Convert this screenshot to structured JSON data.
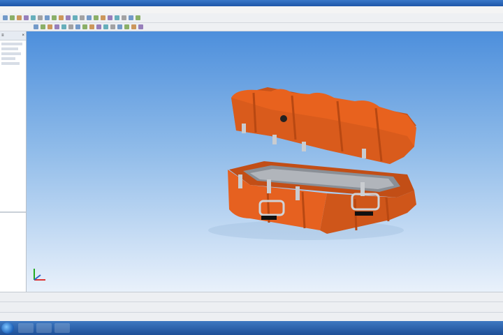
{
  "window": {
    "title": ""
  },
  "menu": {
    "items": []
  },
  "toolbar": {
    "row1_icons": [
      "file-icon",
      "open-icon",
      "save-icon",
      "print-icon",
      "undo-icon",
      "redo-icon",
      "cut-icon",
      "copy-icon",
      "paste-icon",
      "select-icon",
      "zoom-icon",
      "pan-icon",
      "rotate-icon",
      "view-icon",
      "shading-icon",
      "measure-icon",
      "section-icon",
      "layer-icon",
      "settings-icon",
      "help-icon"
    ],
    "row2_icons": [
      "sketch-icon",
      "line-icon",
      "arc-icon",
      "circle-icon",
      "rectangle-icon",
      "dimension-icon",
      "constraint-icon",
      "extrude-icon",
      "revolve-icon",
      "fillet-icon",
      "chamfer-icon",
      "hole-icon",
      "shell-icon",
      "pattern-icon",
      "mirror-icon",
      "assembly-icon"
    ]
  },
  "colors": {
    "model": "#e8621e",
    "viewport_top": "#4d8fdc",
    "viewport_bottom": "#e9f1fb"
  },
  "status": {
    "text": ""
  }
}
